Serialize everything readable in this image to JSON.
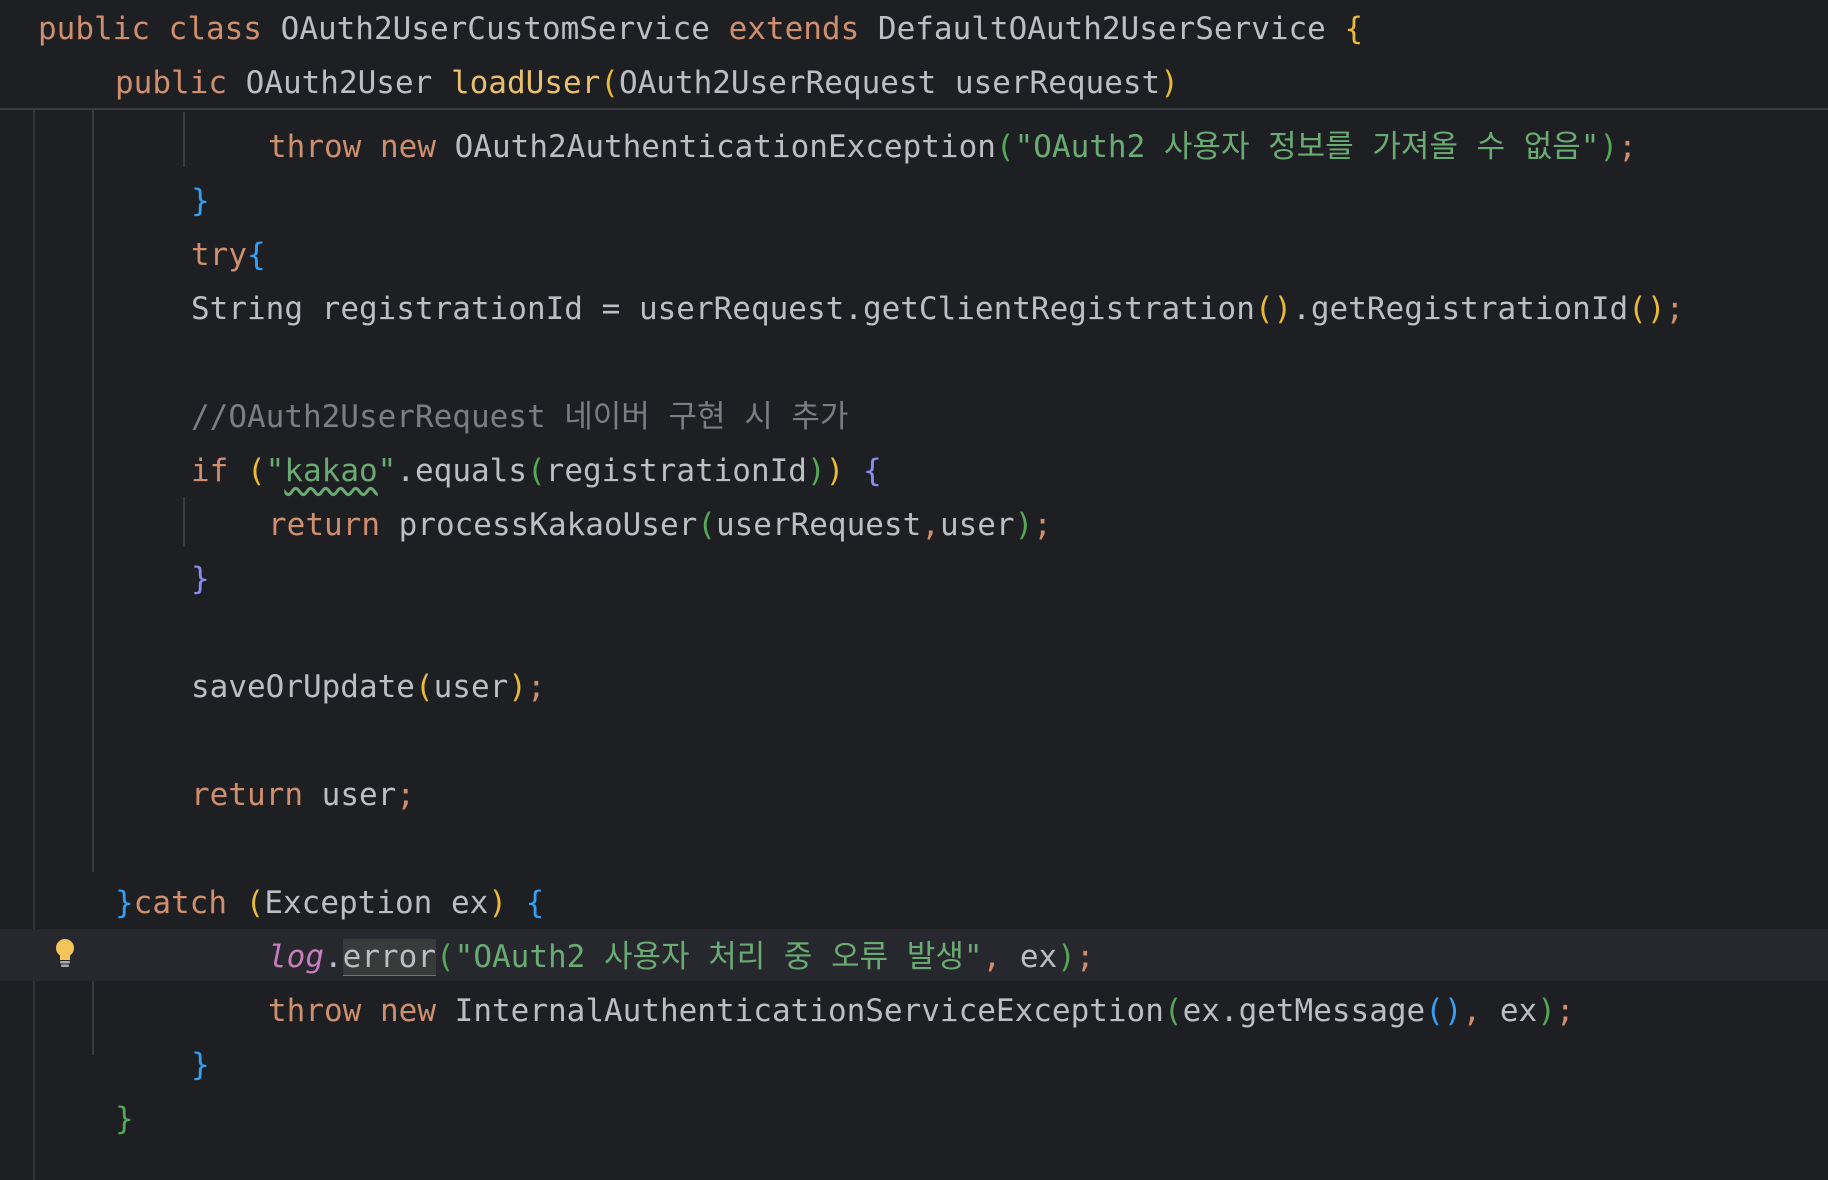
{
  "editor": {
    "sticky_header": {
      "line1": {
        "public": "public",
        "class": "class",
        "class_name": "OAuth2UserCustomService",
        "extends": "extends",
        "parent": "DefaultOAuth2UserService",
        "brace": "{"
      },
      "line2": {
        "public": "public",
        "return_type": "OAuth2User",
        "method": "loadUser",
        "open_paren": "(",
        "param_type": "OAuth2UserRequest",
        "param_name": "userRequest",
        "close_paren": ")"
      }
    },
    "lines": {
      "throw1": {
        "throw": "throw",
        "new": "new",
        "exception": "OAuth2AuthenticationException",
        "open": "(",
        "message": "\"OAuth2 사용자 정보를 가져올 수 없음\"",
        "close": ")",
        "semi": ";"
      },
      "close_if1": "}",
      "try_kw": "try",
      "try_brace": "{",
      "registration": {
        "type": "String",
        "name": "registrationId",
        "eq": "=",
        "expr_start": "userRequest.",
        "call1": "getClientRegistration",
        "call1_parens": "()",
        "dot": ".",
        "call2": "getRegistrationId",
        "call2_parens": "()",
        "semi": ";"
      },
      "comment": "//OAuth2UserRequest 네이버 구현 시 추가",
      "if_kakao": {
        "if": "if",
        "open": "(",
        "quote_open": "\"",
        "kakao": "kakao",
        "quote_close": "\"",
        "equals": ".equals",
        "open2": "(",
        "arg": "registrationId",
        "close2": ")",
        "close": ")",
        "brace": "{"
      },
      "return_kakao": {
        "return": "return",
        "call": "processKakaoUser",
        "open": "(",
        "arg1": "userRequest",
        "comma": ",",
        "arg2": "user",
        "close": ")",
        "semi": ";"
      },
      "close_if2": "}",
      "save": {
        "call": "saveOrUpdate",
        "open": "(",
        "arg": "user",
        "close": ")",
        "semi": ";"
      },
      "return_user": {
        "return": "return",
        "value": "user",
        "semi": ";"
      },
      "catch": {
        "close_brace": "}",
        "catch": "catch",
        "open": "(",
        "type": "Exception",
        "var": "ex",
        "close": ")",
        "brace": "{"
      },
      "log_error": {
        "log": "log",
        "dot": ".",
        "error": "error",
        "open": "(",
        "message": "\"OAuth2 사용자 처리 중 오류 발생\"",
        "comma": ",",
        "arg": "ex",
        "close": ")",
        "semi": ";"
      },
      "throw2": {
        "throw": "throw",
        "new": "new",
        "exception": "InternalAuthenticationServiceException",
        "open": "(",
        "arg_expr": "ex.",
        "call": "getMessage",
        "call_parens": "()",
        "comma": ",",
        "arg2": "ex",
        "close": ")",
        "semi": ";"
      },
      "close_catch": "}",
      "close_method": "}"
    },
    "gutter_icon": "lightbulb-icon"
  }
}
